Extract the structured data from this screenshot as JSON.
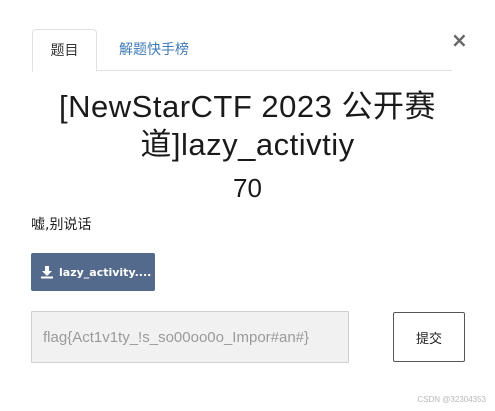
{
  "tabs": {
    "challenge_label": "题目",
    "leaderboard_label": "解题快手榜"
  },
  "close_icon": "×",
  "challenge": {
    "title": "[NewStarCTF 2023 公开赛道]lazy_activtiy",
    "points": "70",
    "description": "嘘,别说话"
  },
  "download": {
    "label": "lazy_activity....",
    "icon": "download-icon"
  },
  "flag": {
    "value": "flag{Act1v1ty_!s_so00oo0o_Impor#an#}",
    "placeholder": "flag{...}"
  },
  "submit_label": "提交",
  "watermark": "CSDN @32304353",
  "colors": {
    "tab_link": "#3f7bb6",
    "download_bg": "#536a8c",
    "input_bg": "#f1f1f1"
  }
}
